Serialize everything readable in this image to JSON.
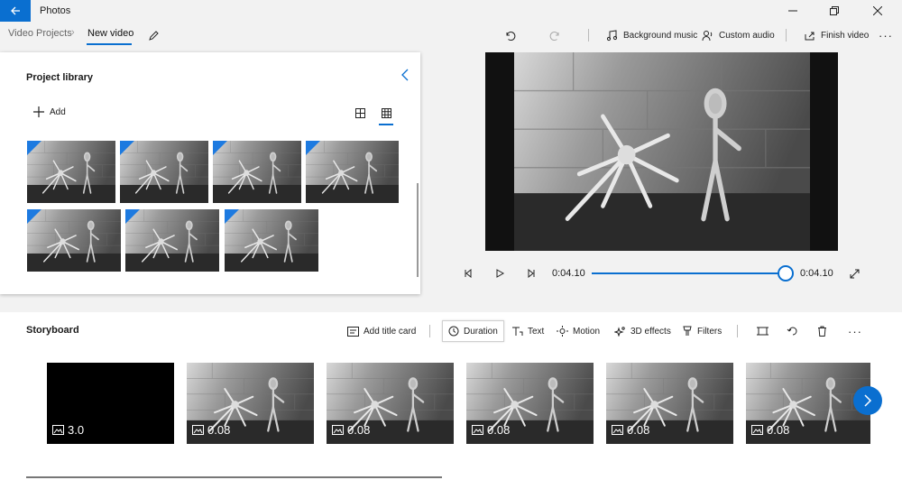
{
  "app": {
    "title": "Photos"
  },
  "breadcrumb": {
    "parent": "Video Projects",
    "current": "New video"
  },
  "toolbar": {
    "background_music": "Background music",
    "custom_audio": "Custom audio",
    "finish_video": "Finish video"
  },
  "library": {
    "title": "Project library",
    "add_label": "Add",
    "thumbnail_count": 7
  },
  "player": {
    "current_time": "0:04.10",
    "total_time": "0:04.10",
    "progress_fraction": 1.0
  },
  "storyboard": {
    "title": "Storyboard",
    "tools": {
      "add_title_card": "Add title card",
      "duration": "Duration",
      "text": "Text",
      "motion": "Motion",
      "effects_3d": "3D effects",
      "filters": "Filters"
    },
    "clips": [
      {
        "type": "title-card",
        "duration": "3.0"
      },
      {
        "type": "photo",
        "duration": "0.08"
      },
      {
        "type": "photo",
        "duration": "0.08"
      },
      {
        "type": "photo",
        "duration": "0.08"
      },
      {
        "type": "photo",
        "duration": "0.08"
      },
      {
        "type": "photo",
        "duration": "0.08"
      }
    ]
  },
  "colors": {
    "accent": "#0a6fd0"
  }
}
